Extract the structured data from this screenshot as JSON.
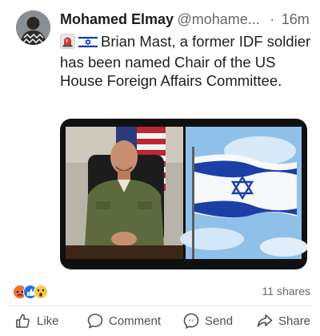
{
  "post": {
    "author": "Mohamed Elmay",
    "handle": "@mohame...",
    "separator": "·",
    "time": "16m",
    "text": "Brian Mast, a former IDF soldier has been named Chair of the US House Foreign Affairs Committee.",
    "text_emojis": [
      "rotating-light-icon",
      "israel-flag-icon"
    ]
  },
  "stats": {
    "reactions": [
      "angry-icon",
      "like-icon",
      "wow-icon"
    ],
    "shares": "11 shares"
  },
  "actions": {
    "like": "Like",
    "comment": "Comment",
    "send": "Send",
    "share": "Share"
  },
  "colors": {
    "text": "#1c1e21",
    "secondary": "#65676b",
    "like_blue": "#1877f2",
    "angry_orange": "#f7714c",
    "israel_blue": "#0038b8"
  }
}
